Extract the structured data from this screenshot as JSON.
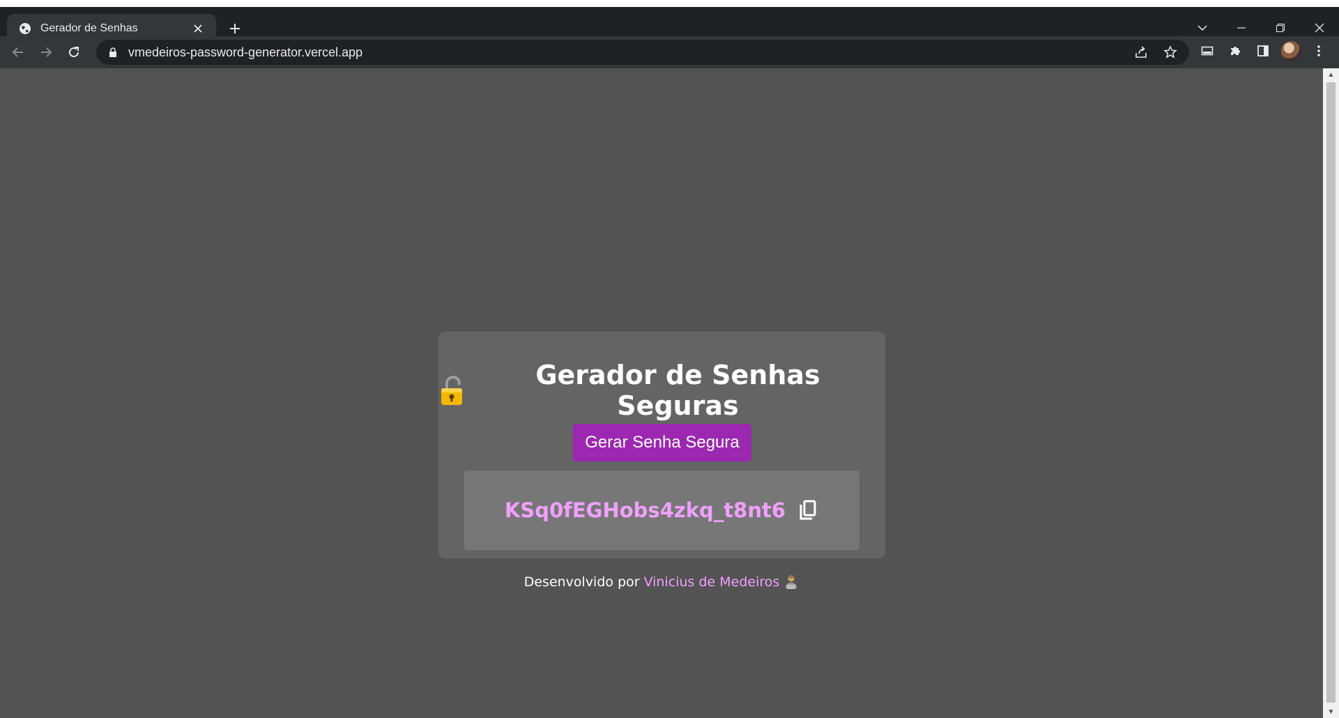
{
  "browser": {
    "tab_title": "Gerador de Senhas",
    "url": "vmedeiros-password-generator.vercel.app",
    "new_tab_label": "+",
    "close_tab_label": "✕"
  },
  "page": {
    "title": "Gerador de Senhas Seguras",
    "button_label": "Gerar Senha Segura",
    "password": "KSq0fEGHobs4zkq_t8nt6",
    "footer_prefix": "Desenvolvido por",
    "footer_author": "Vinicius de Medeiros"
  },
  "colors": {
    "page_background": "#535353",
    "card_background": "#646464",
    "button_background": "#9c27b0",
    "password_color": "#f0a0ff",
    "link_color": "#f0a0ff"
  },
  "icons": {
    "title_icon": "lock-emoji",
    "copy_icon": "copy-icon",
    "footer_icon": "person-emoji"
  }
}
